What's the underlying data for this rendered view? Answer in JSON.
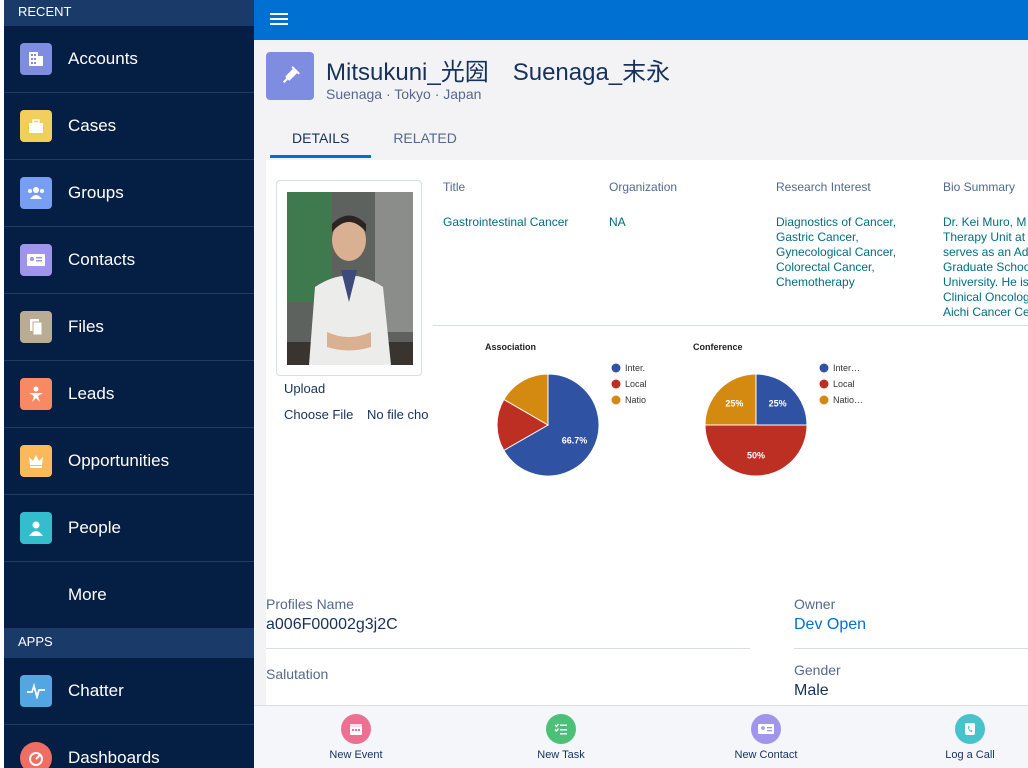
{
  "sidebar": {
    "recent_header": "RECENT",
    "recent_items": [
      {
        "label": "Accounts",
        "icon": "accounts-icon",
        "color": "#7f8de1"
      },
      {
        "label": "Cases",
        "icon": "cases-icon",
        "color": "#f2cf5b"
      },
      {
        "label": "Groups",
        "icon": "groups-icon",
        "color": "#779ef2"
      },
      {
        "label": "Contacts",
        "icon": "contacts-icon",
        "color": "#a094ed"
      },
      {
        "label": "Files",
        "icon": "files-icon",
        "color": "#baac93"
      },
      {
        "label": "Leads",
        "icon": "leads-icon",
        "color": "#f88962"
      },
      {
        "label": "Opportunities",
        "icon": "opportunities-icon",
        "color": "#fcb95b"
      },
      {
        "label": "People",
        "icon": "people-icon",
        "color": "#34becd"
      }
    ],
    "more_label": "More",
    "apps_header": "APPS",
    "apps_items": [
      {
        "label": "Chatter",
        "icon": "chatter-icon",
        "color": "#54a6e3"
      },
      {
        "label": "Dashboards",
        "icon": "dashboards-icon",
        "color": "#ef6e64"
      }
    ]
  },
  "record": {
    "title": "Mitsukuni_光圀　Suenaga_末永",
    "subtitle": "Suenaga · Tokyo · Japan",
    "icon": "syringe-icon",
    "icon_color": "#7f8de1"
  },
  "tabs": [
    {
      "label": "DETAILS",
      "active": true
    },
    {
      "label": "RELATED",
      "active": false
    }
  ],
  "upload": {
    "label": "Upload",
    "button": "Choose File",
    "status": "No file cho"
  },
  "info": {
    "title_header": "Title",
    "title_value": "Gastrointestinal Cancer",
    "org_header": "Organization",
    "org_value": "NA",
    "research_header": "Research Interest",
    "research_values": [
      "Diagnostics of Cancer,",
      "Gastric Cancer,",
      "Gynecological Cancer,",
      "Colorectal Cancer,",
      "Chemotherapy"
    ],
    "bio_header": "Bio Summary",
    "bio_values": [
      "Dr. Kei Muro, M",
      "Therapy Unit at",
      "serves as an Ad",
      "Graduate Schoo",
      "University. He is",
      "Clinical Oncolog",
      "Aichi Cancer Ce"
    ]
  },
  "chart_data": [
    {
      "type": "pie",
      "title": "Association",
      "series": [
        {
          "name": "Inter.",
          "value": 66.7,
          "color": "#2f52a2"
        },
        {
          "name": "Local",
          "value": 16.65,
          "color": "#bd2f23"
        },
        {
          "name": "Natio",
          "value": 16.65,
          "color": "#d48a10"
        }
      ],
      "data_labels": [
        "66.7%",
        "",
        ""
      ],
      "legend": "right"
    },
    {
      "type": "pie",
      "title": "Conference",
      "series": [
        {
          "name": "Inter…",
          "value": 25,
          "color": "#2f52a2"
        },
        {
          "name": "Local",
          "value": 50,
          "color": "#bd2f23"
        },
        {
          "name": "Natio…",
          "value": 25,
          "color": "#d48a10"
        }
      ],
      "data_labels": [
        "25%",
        "50%",
        "25%"
      ],
      "legend": "right"
    }
  ],
  "fields": {
    "profiles_name_label": "Profiles Name",
    "profiles_name_value": "a006F00002g3j2C",
    "owner_label": "Owner",
    "owner_value": "Dev Open",
    "salutation_label": "Salutation",
    "salutation_value": "",
    "gender_label": "Gender",
    "gender_value": "Male"
  },
  "actions": [
    {
      "label": "New Event",
      "icon": "calendar-icon",
      "color": "#eb7092"
    },
    {
      "label": "New Task",
      "icon": "task-icon",
      "color": "#4bc076"
    },
    {
      "label": "New Contact",
      "icon": "contact-card-icon",
      "color": "#a094ed"
    },
    {
      "label": "Log a Call",
      "icon": "phone-icon",
      "color": "#48c3cc"
    }
  ]
}
